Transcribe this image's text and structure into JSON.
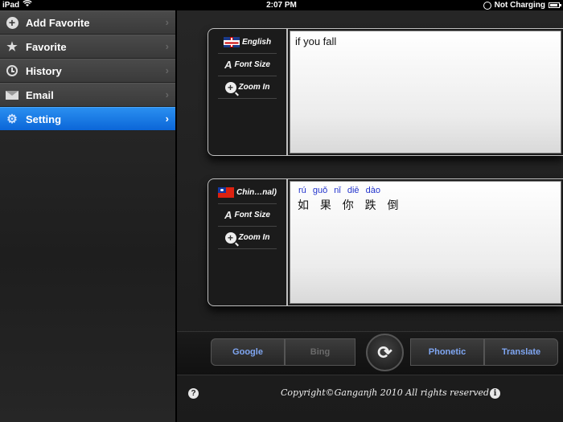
{
  "status_bar": {
    "device": "iPad",
    "time": "2:07 PM",
    "charging": "Not Charging",
    "battery_fraction": 0.85
  },
  "sidebar": {
    "items": [
      {
        "label": "Add Favorite",
        "icon": "add-icon"
      },
      {
        "label": "Favorite",
        "icon": "star-icon"
      },
      {
        "label": "History",
        "icon": "clock-icon"
      },
      {
        "label": "Email",
        "icon": "envelope-icon"
      },
      {
        "label": "Setting",
        "icon": "gear-icon",
        "active": true
      }
    ],
    "active_color": "#1677e6"
  },
  "source_panel": {
    "language": "English",
    "font_size_label": "Font Size",
    "zoom_label": "Zoom In",
    "text": "if you fall"
  },
  "target_panel": {
    "language": "Chin…nal)",
    "font_size_label": "Font Size",
    "zoom_label": "Zoom In",
    "pinyin": "rú guǒ nǐ diē dào",
    "text": "如 果 你 跌 倒"
  },
  "buttons": {
    "google": "Google",
    "bing": "Bing",
    "phonetic": "Phonetic",
    "translate": "Translate",
    "swap_icon": "swap-icon"
  },
  "footer": {
    "copyright": "Copyright©Ganganjh 2010 All rights reserved"
  }
}
